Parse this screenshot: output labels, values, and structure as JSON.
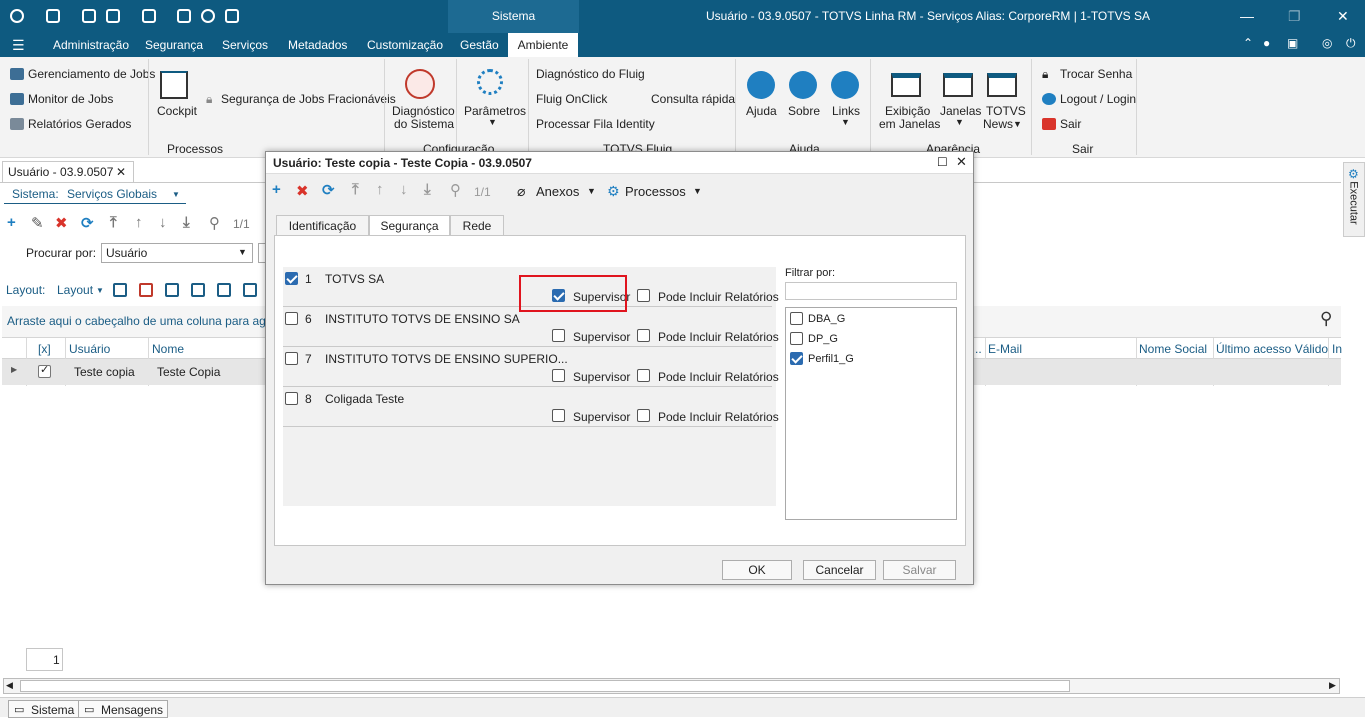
{
  "titlebar": {
    "module_tab": "Sistema",
    "window_title": "Usuário - 03.9.0507 - TOTVS Linha RM - Serviços  Alias: CorporeRM | 1-TOTVS SA"
  },
  "menu": [
    "Administração",
    "Segurança",
    "Serviços",
    "Metadados",
    "Customização",
    "Gestão",
    "Ambiente"
  ],
  "ribbon": {
    "processos": {
      "items": [
        "Gerenciamento de Jobs",
        "Monitor de Jobs",
        "Relatórios Gerados"
      ],
      "cockpit": "Cockpit",
      "seguranca_jobs": "Segurança de Jobs Fracionáveis",
      "group_label": "Processos"
    },
    "configuracao": {
      "diagnostico_l1": "Diagnóstico",
      "diagnostico_l2": "do Sistema",
      "parametros": "Parâmetros",
      "group_label": "Configuração"
    },
    "fluig": {
      "items": [
        "Diagnóstico do Fluig",
        "Fluig OnClick",
        "Processar Fila Identity"
      ],
      "consulta": "Consulta rápida",
      "group_label": "TOTVS Fluig"
    },
    "ajuda": {
      "ajuda": "Ajuda",
      "sobre": "Sobre",
      "links": "Links",
      "group_label": "Ajuda"
    },
    "aparencia": {
      "exibicao_l1": "Exibição",
      "exibicao_l2": "em Janelas",
      "janelas": "Janelas",
      "news_l1": "TOTVS",
      "news_l2": "News",
      "group_label": "Aparência"
    },
    "sair": {
      "items": [
        "Trocar Senha",
        "Logout / Login",
        "Sair"
      ],
      "group_label": "Sair"
    }
  },
  "doc": {
    "tab_label": "Usuário - 03.9.0507",
    "sistema_label": "Sistema:",
    "sistema_value": "Serviços Globais",
    "record_count": "1/1",
    "procurar_label": "Procurar por:",
    "procurar_value": "Usuário",
    "layout_label": "Layout:",
    "layout_menu": "Layout",
    "group_hint": "Arraste aqui o cabeçalho de uma coluna para agrupar",
    "columns": [
      "[x]",
      "Usuário",
      "Nome",
      "E-Mail",
      "Nome Social",
      "Último acesso Válido",
      "In"
    ],
    "row": {
      "usuario": "Teste copia",
      "nome": "Teste Copia"
    },
    "page_number": "1",
    "executar": "Executar"
  },
  "statusbar": {
    "sistema": "Sistema",
    "mensagens": "Mensagens"
  },
  "dialog": {
    "title": "Usuário: Teste copia - Teste Copia - 03.9.0507",
    "record_count": "1/1",
    "anexos": "Anexos",
    "processos": "Processos",
    "tabs": [
      "Identificação",
      "Segurança",
      "Rede"
    ],
    "companies": [
      {
        "code": "1",
        "name": "TOTVS SA",
        "checked": true,
        "supervisor": true,
        "relatorios": false
      },
      {
        "code": "6",
        "name": "INSTITUTO TOTVS DE ENSINO SA",
        "checked": false,
        "supervisor": false,
        "relatorios": false
      },
      {
        "code": "7",
        "name": "INSTITUTO TOTVS DE ENSINO SUPERIO...",
        "checked": false,
        "supervisor": false,
        "relatorios": false
      },
      {
        "code": "8",
        "name": "Coligada Teste",
        "checked": false,
        "supervisor": false,
        "relatorios": false
      }
    ],
    "supervisor_label": "Supervisor",
    "relatorios_label": "Pode Incluir Relatórios",
    "filter_label": "Filtrar por:",
    "filter_value": "",
    "profiles": [
      {
        "name": "DBA_G",
        "checked": false
      },
      {
        "name": "DP_G",
        "checked": false
      },
      {
        "name": "Perfil1_G",
        "checked": true
      }
    ],
    "buttons": {
      "ok": "OK",
      "cancel": "Cancelar",
      "save": "Salvar"
    }
  },
  "colors": {
    "titlebar": "#0e5a80",
    "accent": "#1b5d85",
    "highlight": "#e0141e"
  }
}
